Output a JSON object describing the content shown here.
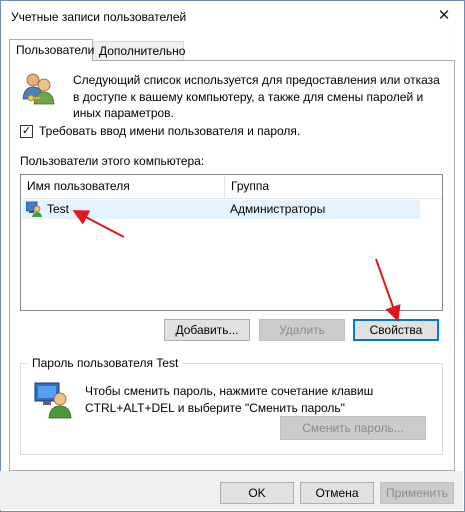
{
  "window": {
    "title": "Учетные записи пользователей",
    "close_glyph": "✕"
  },
  "tabs": [
    {
      "label": "Пользователи",
      "active": true
    },
    {
      "label": "Дополнительно",
      "active": false
    }
  ],
  "intro": {
    "line1": "Следующий список используется для предоставления или отказа",
    "line2": "в доступе к вашему компьютеру, а также для смены паролей и",
    "line3": "иных параметров."
  },
  "require_login": {
    "label": "Требовать ввод имени пользователя и пароля.",
    "checked": true,
    "check_glyph": "✓"
  },
  "users_section": {
    "label": "Пользователи этого компьютера:",
    "columns": [
      "Имя пользователя",
      "Группа"
    ],
    "rows": [
      {
        "name": "Test",
        "group": "Администраторы",
        "selected": true
      }
    ]
  },
  "buttons": {
    "add": "Добавить...",
    "remove": "Удалить",
    "properties": "Свойства"
  },
  "password_group": {
    "title": "Пароль пользователя Test",
    "line1": "Чтобы сменить пароль, нажмите сочетание клавиш",
    "line2": "CTRL+ALT+DEL и выберите \"Сменить пароль\"",
    "change_button": "Сменить пароль..."
  },
  "footer": {
    "ok": "OK",
    "cancel": "Отмена",
    "apply": "Применить"
  },
  "colors": {
    "accent": "#0078d7",
    "selection": "#e5f3ff",
    "annotation_arrow": "#e3161b"
  }
}
